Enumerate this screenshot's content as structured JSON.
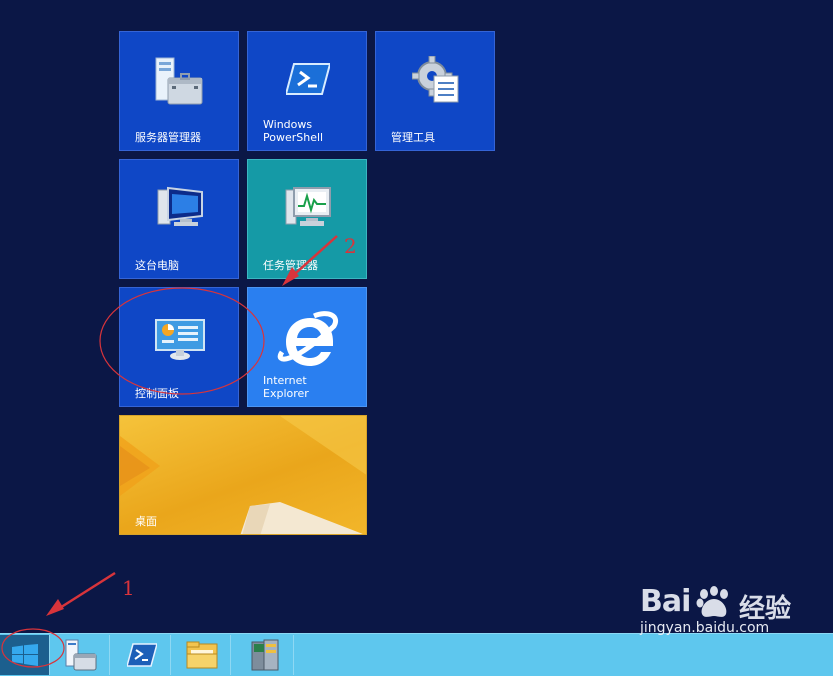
{
  "tiles": {
    "server_manager": "服务器管理器",
    "powershell": "Windows\nPowerShell",
    "admin_tools": "管理工具",
    "this_pc": "这台电脑",
    "task_manager": "任务管理器",
    "control_panel": "控制面板",
    "internet_explorer": "Internet\nExplorer",
    "desktop": "桌面"
  },
  "taskbar": {
    "items": [
      "start",
      "server-manager",
      "powershell",
      "file-explorer",
      "admin-tools"
    ]
  },
  "annotations": {
    "step1": "1",
    "step2": "2",
    "color": "#d8343b"
  },
  "watermark": {
    "brand": "Bai",
    "brand_suffix": "经验",
    "url": "jingyan.baidu.com"
  },
  "colors": {
    "background": "#0b1746",
    "tile_blue": "#0f47c6",
    "tile_teal": "#159aa6",
    "tile_ie": "#2a7ff0",
    "taskbar": "#5ec7ee"
  }
}
